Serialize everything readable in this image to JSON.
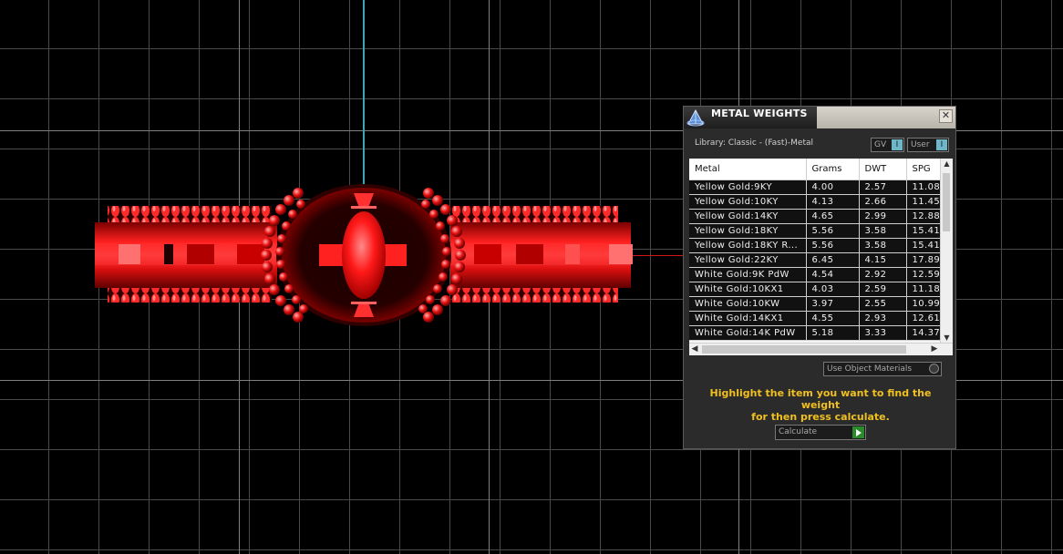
{
  "panel": {
    "title": "METAL WEIGHTS",
    "close_glyph": "✕",
    "library_label": "Library: Classic - (Fast)-Metal",
    "toggle_gv": "GV",
    "toggle_user": "User",
    "toggle_knob": "I",
    "columns": [
      "Metal",
      "Grams",
      "DWT",
      "SPG"
    ],
    "rows": [
      [
        "Yellow Gold:9KY",
        "4.00",
        "2.57",
        "11.08"
      ],
      [
        "Yellow Gold:10KY",
        "4.13",
        "2.66",
        "11.45"
      ],
      [
        "Yellow Gold:14KY",
        "4.65",
        "2.99",
        "12.88"
      ],
      [
        "Yellow Gold:18KY",
        "5.56",
        "3.58",
        "15.41"
      ],
      [
        "Yellow Gold:18KY R...",
        "5.56",
        "3.58",
        "15.41"
      ],
      [
        "Yellow Gold:22KY",
        "6.45",
        "4.15",
        "17.89"
      ],
      [
        "White Gold:9K PdW",
        "4.54",
        "2.92",
        "12.59"
      ],
      [
        "White Gold:10KX1",
        "4.03",
        "2.59",
        "11.18"
      ],
      [
        "White Gold:10KW",
        "3.97",
        "2.55",
        "10.99"
      ],
      [
        "White Gold:14KX1",
        "4.55",
        "2.93",
        "12.61"
      ],
      [
        "White Gold:14K PdW",
        "5.18",
        "3.33",
        "14.37"
      ]
    ],
    "use_object_materials": "Use Object Materials",
    "hint_line1": "Highlight the item you want to find the weight",
    "hint_line2": "for then press calculate.",
    "calculate_label": "Calculate"
  },
  "icons": {
    "logo": "pyramid-logo-icon",
    "close": "close-icon",
    "calculate_go": "play-icon"
  },
  "colors": {
    "panel_bg": "#2b2b2b",
    "hint": "#f0c020",
    "model_red": "#e01010",
    "axis_cyan": "#3aa7b5",
    "grid": "#4a4a4a"
  }
}
